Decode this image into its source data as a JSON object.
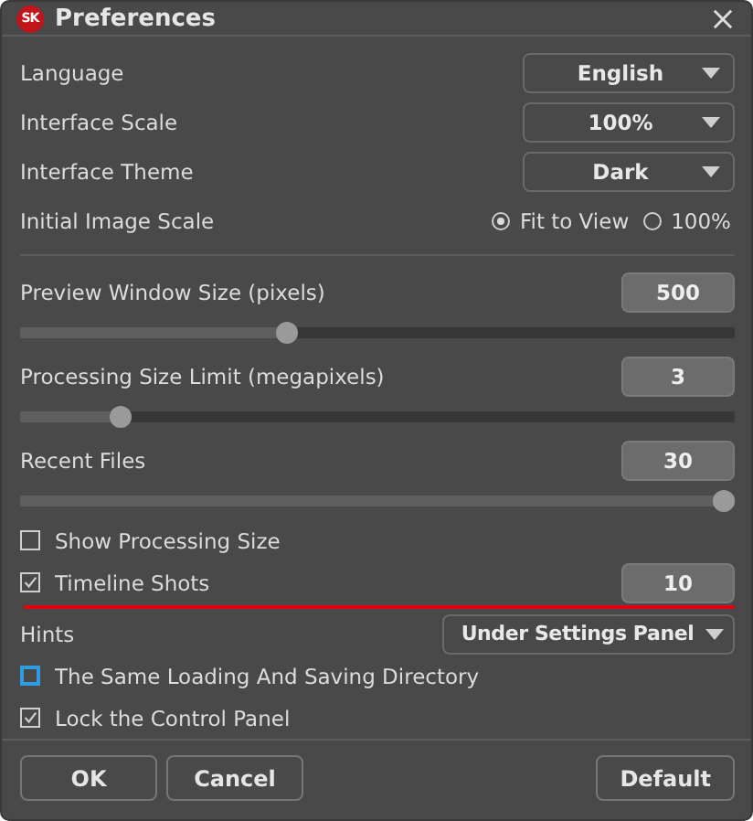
{
  "window": {
    "title": "Preferences",
    "logo": "SK"
  },
  "dropdowns": [
    {
      "label": "Language",
      "value": "English"
    },
    {
      "label": "Interface Scale",
      "value": "100%"
    },
    {
      "label": "Interface Theme",
      "value": "Dark"
    }
  ],
  "image_scale": {
    "label": "Initial Image Scale",
    "options": [
      {
        "label": "Fit to View",
        "selected": true
      },
      {
        "label": "100%",
        "selected": false
      }
    ]
  },
  "sliders": [
    {
      "label": "Preview Window Size (pixels)",
      "value": "500",
      "level": 0.37
    },
    {
      "label": "Processing Size Limit (megapixels)",
      "value": "3",
      "level": 0.13
    },
    {
      "label": "Recent Files",
      "value": "30",
      "level": 1.0
    }
  ],
  "options": [
    {
      "kind": "checkbox",
      "label": "Show Processing Size",
      "checked": false,
      "focused": false
    },
    {
      "kind": "checkbox-value",
      "label": "Timeline Shots",
      "checked": true,
      "focused": false,
      "value": "10"
    },
    {
      "kind": "dropdown",
      "label": "Hints",
      "value": "Under Settings Panel"
    },
    {
      "kind": "checkbox",
      "label": "The Same Loading And Saving Directory",
      "checked": false,
      "focused": true
    },
    {
      "kind": "checkbox",
      "label": "Lock the Control Panel",
      "checked": true,
      "focused": false
    }
  ],
  "buttons": [
    {
      "label": "OK",
      "kind": "left"
    },
    {
      "label": "Cancel",
      "kind": "left"
    },
    {
      "label": "Default",
      "kind": "right"
    }
  ]
}
